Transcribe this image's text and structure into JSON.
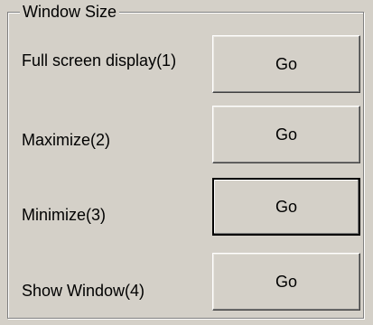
{
  "group": {
    "title": "Window Size"
  },
  "rows": [
    {
      "label": "Full screen display(1)",
      "button": "Go",
      "focused": false
    },
    {
      "label": "Maximize(2)",
      "button": "Go",
      "focused": false
    },
    {
      "label": "Minimize(3)",
      "button": "Go",
      "focused": true
    },
    {
      "label": "Show Window(4)",
      "button": "Go",
      "focused": false
    }
  ]
}
